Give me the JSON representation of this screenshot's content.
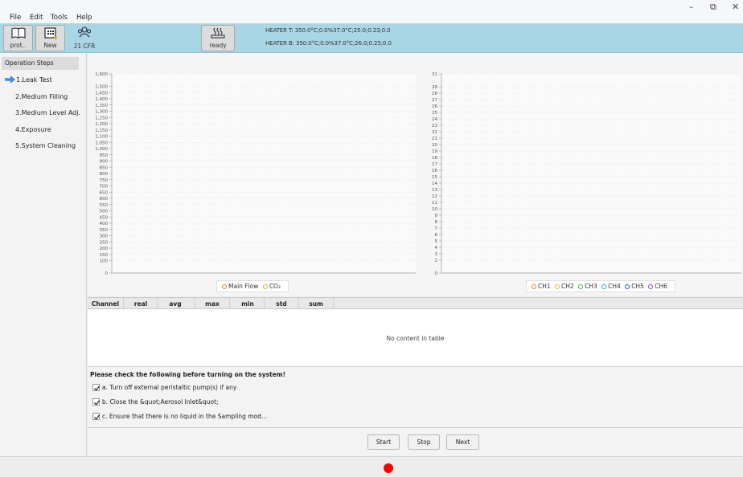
{
  "menu": [
    "File",
    "Edit",
    "Tools",
    "Help"
  ],
  "window_controls": {
    "minimize": "–",
    "restore": "⧉",
    "close": "✕"
  },
  "toolbar": {
    "buttons": [
      {
        "label": "prot..",
        "icon": "book-icon"
      },
      {
        "label": "New",
        "icon": "grid-icon"
      },
      {
        "label": "21 CFR",
        "icon": "users-icon"
      }
    ],
    "status": {
      "label": "ready",
      "icon": "heater-icon"
    },
    "heater_t": "HEATER T:  350.0°C;0.0%37.0°C;25.0;0.23;0.0",
    "heater_b": "HEATER B:   350.0°C;0.0%37.0°C;26.0;0.25;0.0"
  },
  "sidebar": {
    "header": "Operation Steps",
    "steps": [
      "1.Leak Test",
      "2.Medium Filling",
      "3.Medium Level Adj.",
      "4.Exposure",
      "5.System Cleaning"
    ],
    "active_index": 0
  },
  "chart_data": [
    {
      "type": "line",
      "y_ticks": [
        "1,600",
        "1,500",
        "1,450",
        "1,400",
        "1,350",
        "1,300",
        "1,250",
        "1,200",
        "1,150",
        "1,100",
        "1,050",
        "1,000",
        "950",
        "900",
        "850",
        "800",
        "750",
        "700",
        "650",
        "600",
        "550",
        "500",
        "450",
        "400",
        "350",
        "300",
        "250",
        "200",
        "150",
        "100",
        "0"
      ],
      "ylim": [
        0,
        1600
      ],
      "grid": true,
      "legend_position": "bottom-center",
      "series": [
        {
          "name": "Main Flow",
          "color": "#f07a1a",
          "values": []
        },
        {
          "name": "CO₂",
          "color": "#e8b020",
          "values": []
        }
      ]
    },
    {
      "type": "line",
      "y_ticks": [
        "31",
        "29",
        "28",
        "27",
        "26",
        "25",
        "24",
        "23",
        "22",
        "21",
        "20",
        "19",
        "18",
        "17",
        "16",
        "15",
        "14",
        "13",
        "12",
        "11",
        "10",
        "9",
        "8",
        "7",
        "6",
        "5",
        "4",
        "3",
        "2",
        "0"
      ],
      "ylim": [
        0,
        31
      ],
      "grid": true,
      "legend_position": "bottom-center",
      "series": [
        {
          "name": "CH1",
          "color": "#f07a1a",
          "values": []
        },
        {
          "name": "CH2",
          "color": "#e8b020",
          "values": []
        },
        {
          "name": "CH3",
          "color": "#3cb44b",
          "values": []
        },
        {
          "name": "CH4",
          "color": "#29a8d8",
          "values": []
        },
        {
          "name": "CH5",
          "color": "#2f4fd8",
          "values": []
        },
        {
          "name": "CH6",
          "color": "#8e3fd0",
          "values": []
        }
      ]
    }
  ],
  "table": {
    "columns": [
      "Channel",
      "real",
      "avg",
      "max",
      "min",
      "std",
      "sum"
    ],
    "empty_text": "No content in table"
  },
  "checklist": {
    "title": "Please check the following before turning on the system!",
    "items": [
      {
        "label": "a. Turn off external peristaltic pump(s) if any",
        "checked": true
      },
      {
        "label": "b. Close the &quot;Aerosol Inlet&quot;",
        "checked": true
      },
      {
        "label": "c. Ensure that there is no liquid in the Sampling mod...",
        "checked": true
      }
    ]
  },
  "actions": {
    "start": "Start",
    "stop": "Stop",
    "next": "Next"
  },
  "status_indicator_color": "#ff0000"
}
